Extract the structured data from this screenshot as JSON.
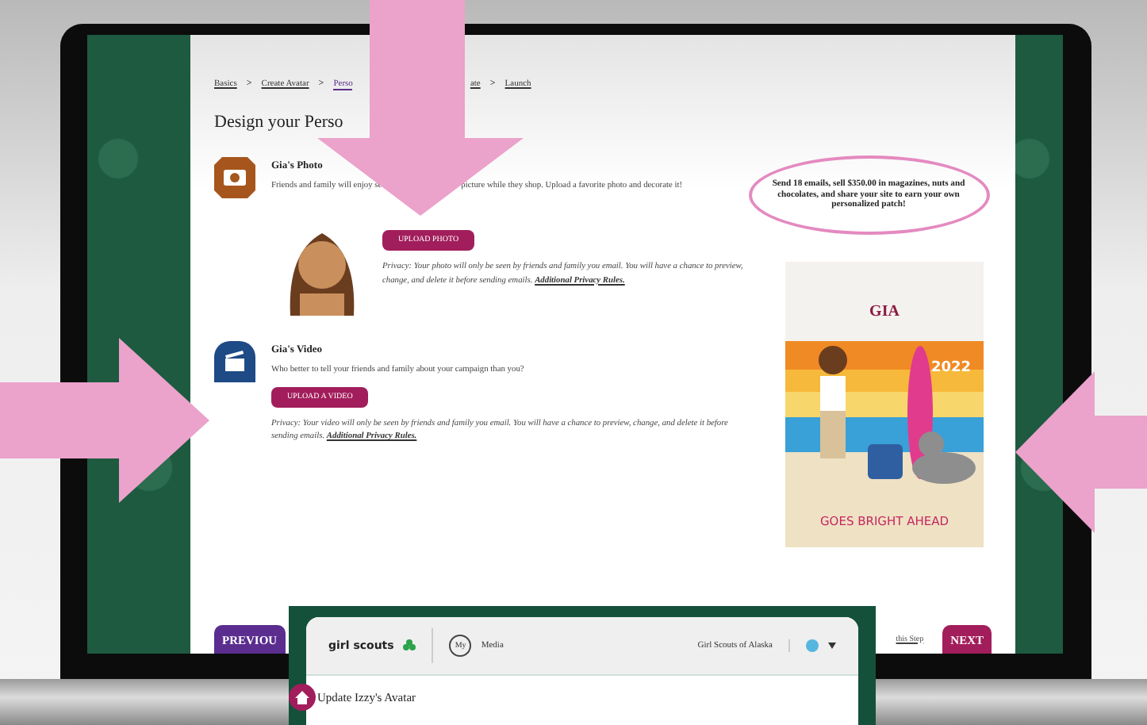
{
  "breadcrumb": [
    {
      "label": "Basics",
      "selected": false,
      "separator": ">"
    },
    {
      "label": "Create Avatar",
      "selected": false,
      "separator": ">"
    },
    {
      "label": "Perso",
      "selected": true
    },
    {
      "label": "ate",
      "selected": false,
      "separator": ">"
    },
    {
      "label": "Launch",
      "selected": false
    }
  ],
  "heading": "Design your Perso",
  "photo_section": {
    "title": "Gia's Photo",
    "description_parts": [
      "Friends and family will enjoy se",
      "picture while they shop. Upload a favorite photo and decorate it!"
    ],
    "button": "UPLOAD PHOTO",
    "privacy": "Privacy: Your photo will only be seen by friends and family you email. You will have a chance to preview, change, and delete it before sending emails.",
    "privacy_link": "Additional Privacy Rules."
  },
  "video_section": {
    "title": "Gia's Video",
    "description": "Who better to tell your friends and family about your campaign than you?",
    "button": "UPLOAD A VIDEO",
    "privacy": "Privacy: Your video will only be seen by friends and family you email. You will have a chance to preview, change, and delete it before sending emails.",
    "privacy_link": "Additional Privacy Rules."
  },
  "goal_note": "Send 18 emails, sell $350.00 in magazines, nuts and chocolates, and share your site to earn your own personalized patch!",
  "patch": {
    "name": "GIA",
    "year": "2022",
    "slogan": "GOES BRIGHT AHEAD"
  },
  "footer": {
    "previous": "PREVIOU",
    "skip": "this Step",
    "next": "NEXT"
  },
  "overlay_screen": {
    "logo": "girl scouts",
    "my_badge": "My",
    "media": "Media",
    "council": "Girl Scouts of Alaska",
    "page_title": "Update Izzy's Avatar"
  }
}
